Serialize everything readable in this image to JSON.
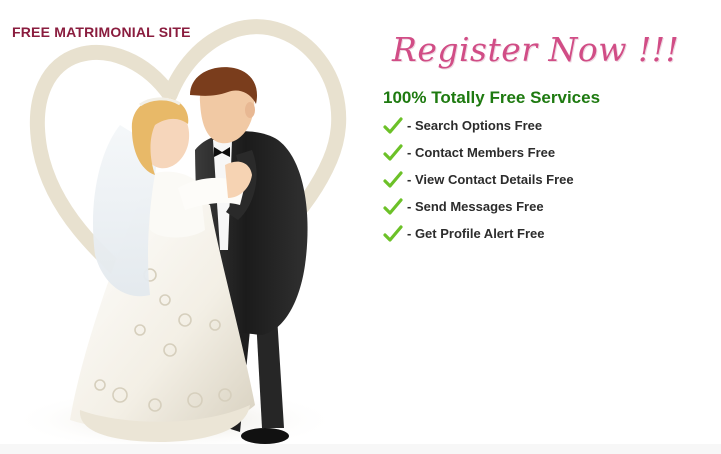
{
  "header": {
    "site_title": "FREE MATRIMONIAL SITE"
  },
  "hero": {
    "register_label": "Register Now !!!",
    "services_heading": "100% Totally Free Services"
  },
  "services": [
    {
      "label": "- Search Options Free",
      "icon": "check-icon"
    },
    {
      "label": "- Contact Members Free",
      "icon": "check-icon"
    },
    {
      "label": "- View Contact Details Free",
      "icon": "check-icon"
    },
    {
      "label": "- Send Messages Free",
      "icon": "check-icon"
    },
    {
      "label": "- Get Profile Alert Free",
      "icon": "check-icon"
    }
  ],
  "colors": {
    "site_title": "#8a1c3e",
    "register": "#d14d86",
    "heading_green": "#1e7a10",
    "check_green": "#6cc128",
    "heart": "#e8e1cf"
  }
}
